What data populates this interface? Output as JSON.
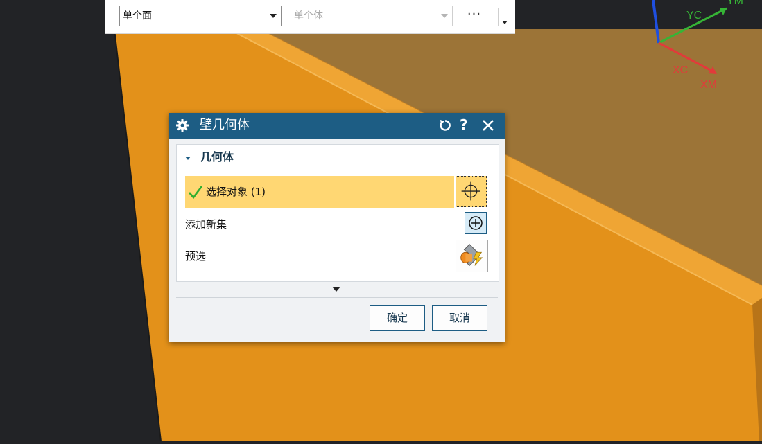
{
  "toolbar": {
    "face_filter": "单个面",
    "body_filter": "单个体",
    "more": "···"
  },
  "dialog": {
    "title": "壁几何体",
    "help": "?",
    "group_title": "几何体",
    "select_object": "选择对象 (1)",
    "add_new_set": "添加新集",
    "preselect": "预选",
    "ok": "确定",
    "cancel": "取消"
  },
  "triad": {
    "yc": "YC",
    "ym": "YM",
    "xc": "XC",
    "xm": "XM"
  },
  "colors": {
    "part_orange": "#e8961c",
    "title_bar": "#1d5d84",
    "highlight": "#ffd773"
  }
}
